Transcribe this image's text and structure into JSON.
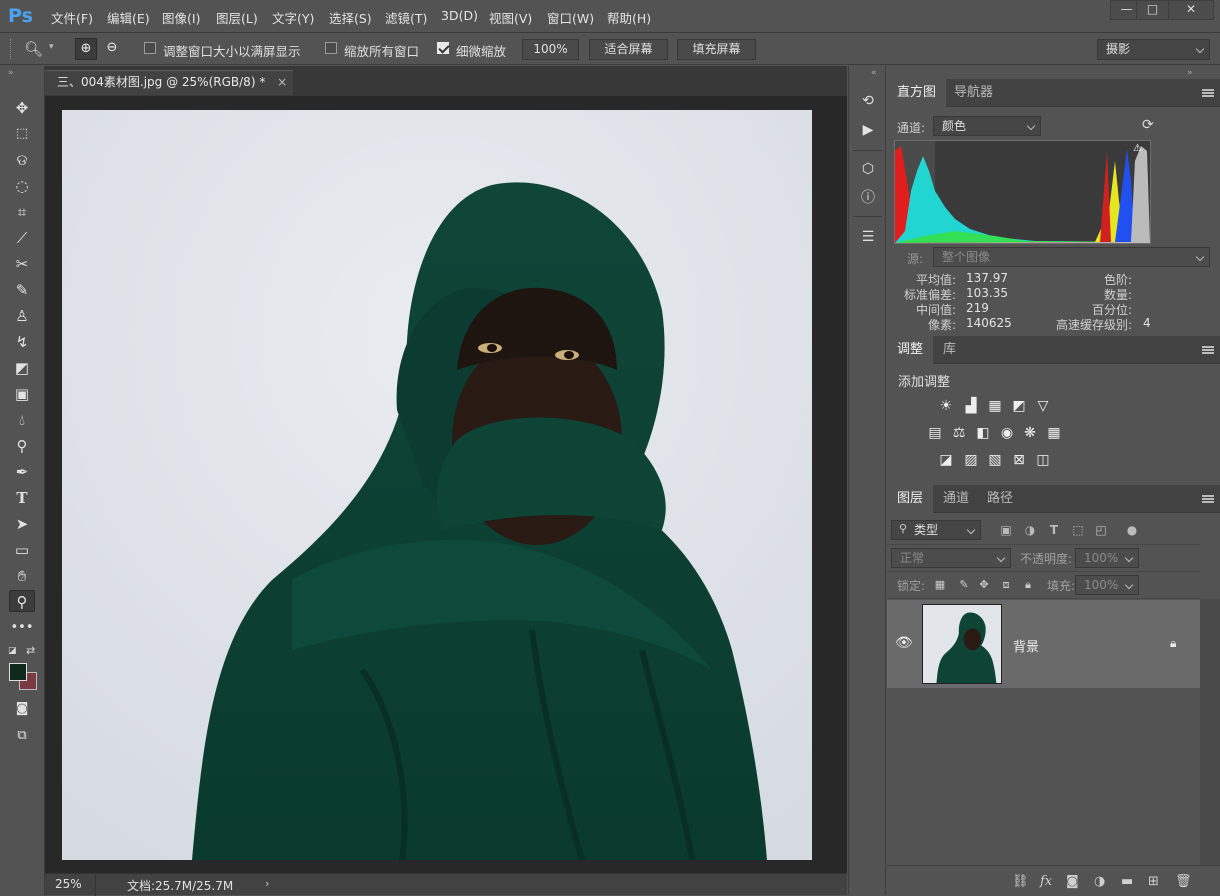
{
  "app": {
    "logo": "Ps"
  },
  "menu": [
    "文件(F)",
    "编辑(E)",
    "图像(I)",
    "图层(L)",
    "文字(Y)",
    "选择(S)",
    "滤镜(T)",
    "3D(D)",
    "视图(V)",
    "窗口(W)",
    "帮助(H)"
  ],
  "window_controls": {
    "minimize": "—",
    "maximize": "□",
    "close": "✕"
  },
  "options": {
    "resize_windows_label": "调整窗口大小以满屏显示",
    "resize_windows_checked": false,
    "zoom_all_label": "缩放所有窗口",
    "zoom_all_checked": false,
    "scrubby_label": "细微缩放",
    "scrubby_checked": true,
    "zoom_btn": "100%",
    "fit_btn": "适合屏幕",
    "fill_btn": "填充屏幕",
    "workspace": "摄影"
  },
  "document": {
    "tab_title": "三、004素材图.jpg @ 25%(RGB/8) *",
    "zoom": "25%",
    "doc_size": "文档:25.7M/25.7M"
  },
  "histogram": {
    "tabs": [
      "直方图",
      "导航器"
    ],
    "channel_label": "通道:",
    "channel_value": "颜色",
    "source_label": "源:",
    "source_value": "整个图像",
    "stats_left": [
      {
        "label": "平均值:",
        "value": "137.97"
      },
      {
        "label": "标准偏差:",
        "value": "103.35"
      },
      {
        "label": "中间值:",
        "value": "219"
      },
      {
        "label": "像素:",
        "value": "140625"
      }
    ],
    "stats_right": [
      {
        "label": "色阶:",
        "value": ""
      },
      {
        "label": "数量:",
        "value": ""
      },
      {
        "label": "百分位:",
        "value": ""
      },
      {
        "label": "高速缓存级别:",
        "value": "4"
      }
    ]
  },
  "adjustments": {
    "tabs": [
      "调整",
      "库"
    ],
    "add_label": "添加调整",
    "row1": [
      "brightness-icon",
      "levels-icon",
      "curves-icon",
      "exposure-icon",
      "vibrance-icon"
    ],
    "row2": [
      "hue-saturation-icon",
      "color-balance-icon",
      "black-white-icon",
      "photo-filter-icon",
      "channel-mixer-icon",
      "color-lookup-icon"
    ],
    "row3": [
      "invert-icon",
      "posterize-icon",
      "threshold-icon",
      "gradient-map-icon",
      "selective-color-icon"
    ]
  },
  "layers": {
    "tabs": [
      "图层",
      "通道",
      "路径"
    ],
    "filter_label": "类型",
    "blend_mode": "正常",
    "opacity_label": "不透明度:",
    "opacity_value": "100%",
    "lock_label": "锁定:",
    "fill_label": "填充:",
    "fill_value": "100%",
    "items": [
      {
        "name": "背景",
        "visible": true,
        "locked": true
      }
    ]
  },
  "colors": {
    "foreground": "#0f2a1c",
    "background": "#7a3a40",
    "accent": "#4aa3f5"
  }
}
